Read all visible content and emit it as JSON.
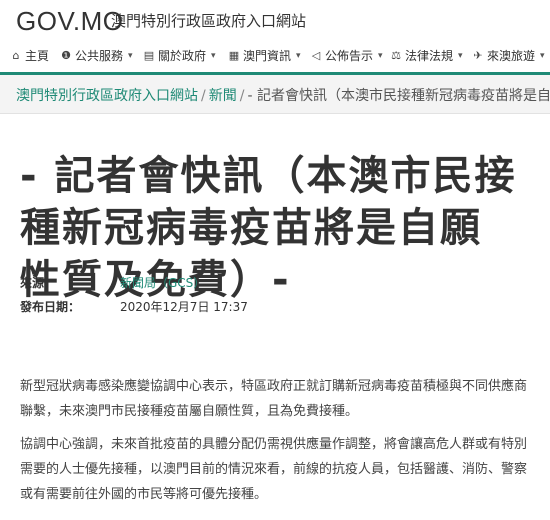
{
  "header": {
    "logo": "GOV.MO",
    "site_name": "澳門特別行政區政府入口網站"
  },
  "nav": [
    {
      "label": "主頁",
      "icon": "home-icon",
      "glyph": "⌂",
      "dropdown": false
    },
    {
      "label": "公共服務",
      "icon": "info-icon",
      "glyph": "❶",
      "dropdown": true
    },
    {
      "label": "關於政府",
      "icon": "document-icon",
      "glyph": "▤",
      "dropdown": true
    },
    {
      "label": "澳門資訊",
      "icon": "map-icon",
      "glyph": "▦",
      "dropdown": true
    },
    {
      "label": "公佈告示",
      "icon": "megaphone-icon",
      "glyph": "◁",
      "dropdown": true
    },
    {
      "label": "法律法規",
      "icon": "balance-icon",
      "glyph": "⚖",
      "dropdown": true
    },
    {
      "label": "來澳旅遊",
      "icon": "plane-icon",
      "glyph": "✈",
      "dropdown": true
    }
  ],
  "breadcrumb": {
    "home": "澳門特別行政區政府入口網站",
    "section": "新聞",
    "current": "- 記者會快訊（本澳市民接種新冠病毒疫苗將是自願性質及免費）-"
  },
  "article": {
    "title": "- 記者會快訊（本澳市民接種新冠病毒疫苗將是自願性質及免費）-",
    "source_label": "來源",
    "source_value": "新聞局（GCS）",
    "date_label": "發布日期：",
    "date_value": "2020年12月7日 17:37",
    "paragraphs": [
      "新型冠狀病毒感染應變協調中心表示，特區政府正就訂購新冠病毒疫苗積極與不同供應商聯繫，未來澳門市民接種疫苗屬自願性質，且為免費接種。",
      "協調中心強調，未來首批疫苗的具體分配仍需視供應量作調整，將會讓高危人群或有特別需要的人士優先接種，以澳門目前的情況來看，前線的抗疫人員，包括醫護、消防、警察或有需要前往外國的市民等將可優先接種。"
    ]
  },
  "colors": {
    "accent": "#1f8a76"
  }
}
